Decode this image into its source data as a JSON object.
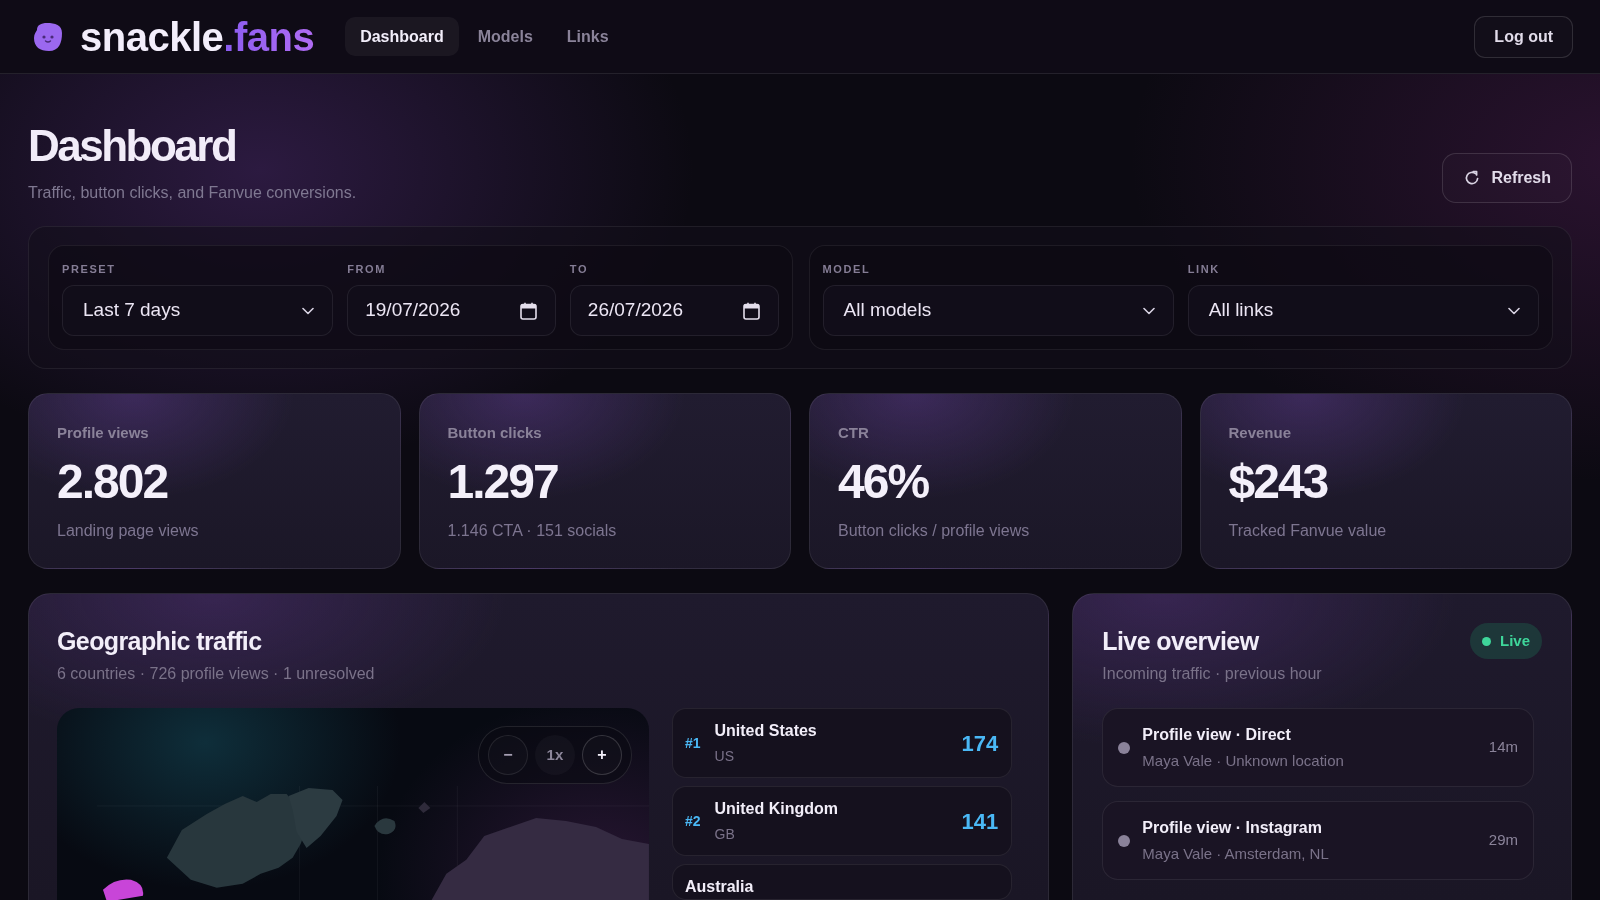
{
  "nav": {
    "brand": {
      "name": "snackle",
      "accent": ".fans"
    },
    "links": [
      {
        "label": "Dashboard",
        "selected": true
      },
      {
        "label": "Models",
        "selected": false
      },
      {
        "label": "Links",
        "selected": false
      }
    ],
    "logout": "Log out"
  },
  "header": {
    "title": "Dashboard",
    "subtitle": "Traffic, button clicks, and Fanvue conversions.",
    "refresh": "Refresh"
  },
  "filters": {
    "groups": [
      {
        "fields": [
          {
            "label": "PRESET",
            "kind": "select",
            "value": "Last 7 days"
          },
          {
            "label": "FROM",
            "kind": "date",
            "value": "19/07/2026"
          },
          {
            "label": "TO",
            "kind": "date",
            "value": "26/07/2026"
          }
        ]
      },
      {
        "fields": [
          {
            "label": "MODEL",
            "kind": "select",
            "value": "All models"
          },
          {
            "label": "LINK",
            "kind": "select",
            "value": "All links"
          }
        ]
      }
    ]
  },
  "stats": [
    {
      "label": "Profile views",
      "value": "2.802",
      "note": "Landing page views"
    },
    {
      "label": "Button clicks",
      "value": "1.297",
      "note": "1.146 CTA · 151 socials"
    },
    {
      "label": "CTR",
      "value": "46%",
      "note": "Button clicks / profile views"
    },
    {
      "label": "Revenue",
      "value": "$243",
      "note": "Tracked Fanvue value"
    }
  ],
  "geo": {
    "title": "Geographic traffic",
    "subtitle": "6 countries · 726 profile views · 1 unresolved",
    "map": {
      "zoom_out": "−",
      "zoom_level": "1x",
      "zoom_in": "+"
    },
    "countries": [
      {
        "rank": "#1",
        "name": "United States",
        "code": "US",
        "count": "174"
      },
      {
        "rank": "#2",
        "name": "United Kingdom",
        "code": "GB",
        "count": "141"
      },
      {
        "name": "Australia"
      }
    ]
  },
  "live": {
    "title": "Live overview",
    "subtitle": "Incoming traffic · previous hour",
    "badge": "Live",
    "events": [
      {
        "title": "Profile view · Direct",
        "detail": "Maya Vale · Unknown location",
        "age": "14m"
      },
      {
        "title": "Profile view · Instagram",
        "detail": "Maya Vale · Amsterdam, NL",
        "age": "29m"
      }
    ]
  }
}
